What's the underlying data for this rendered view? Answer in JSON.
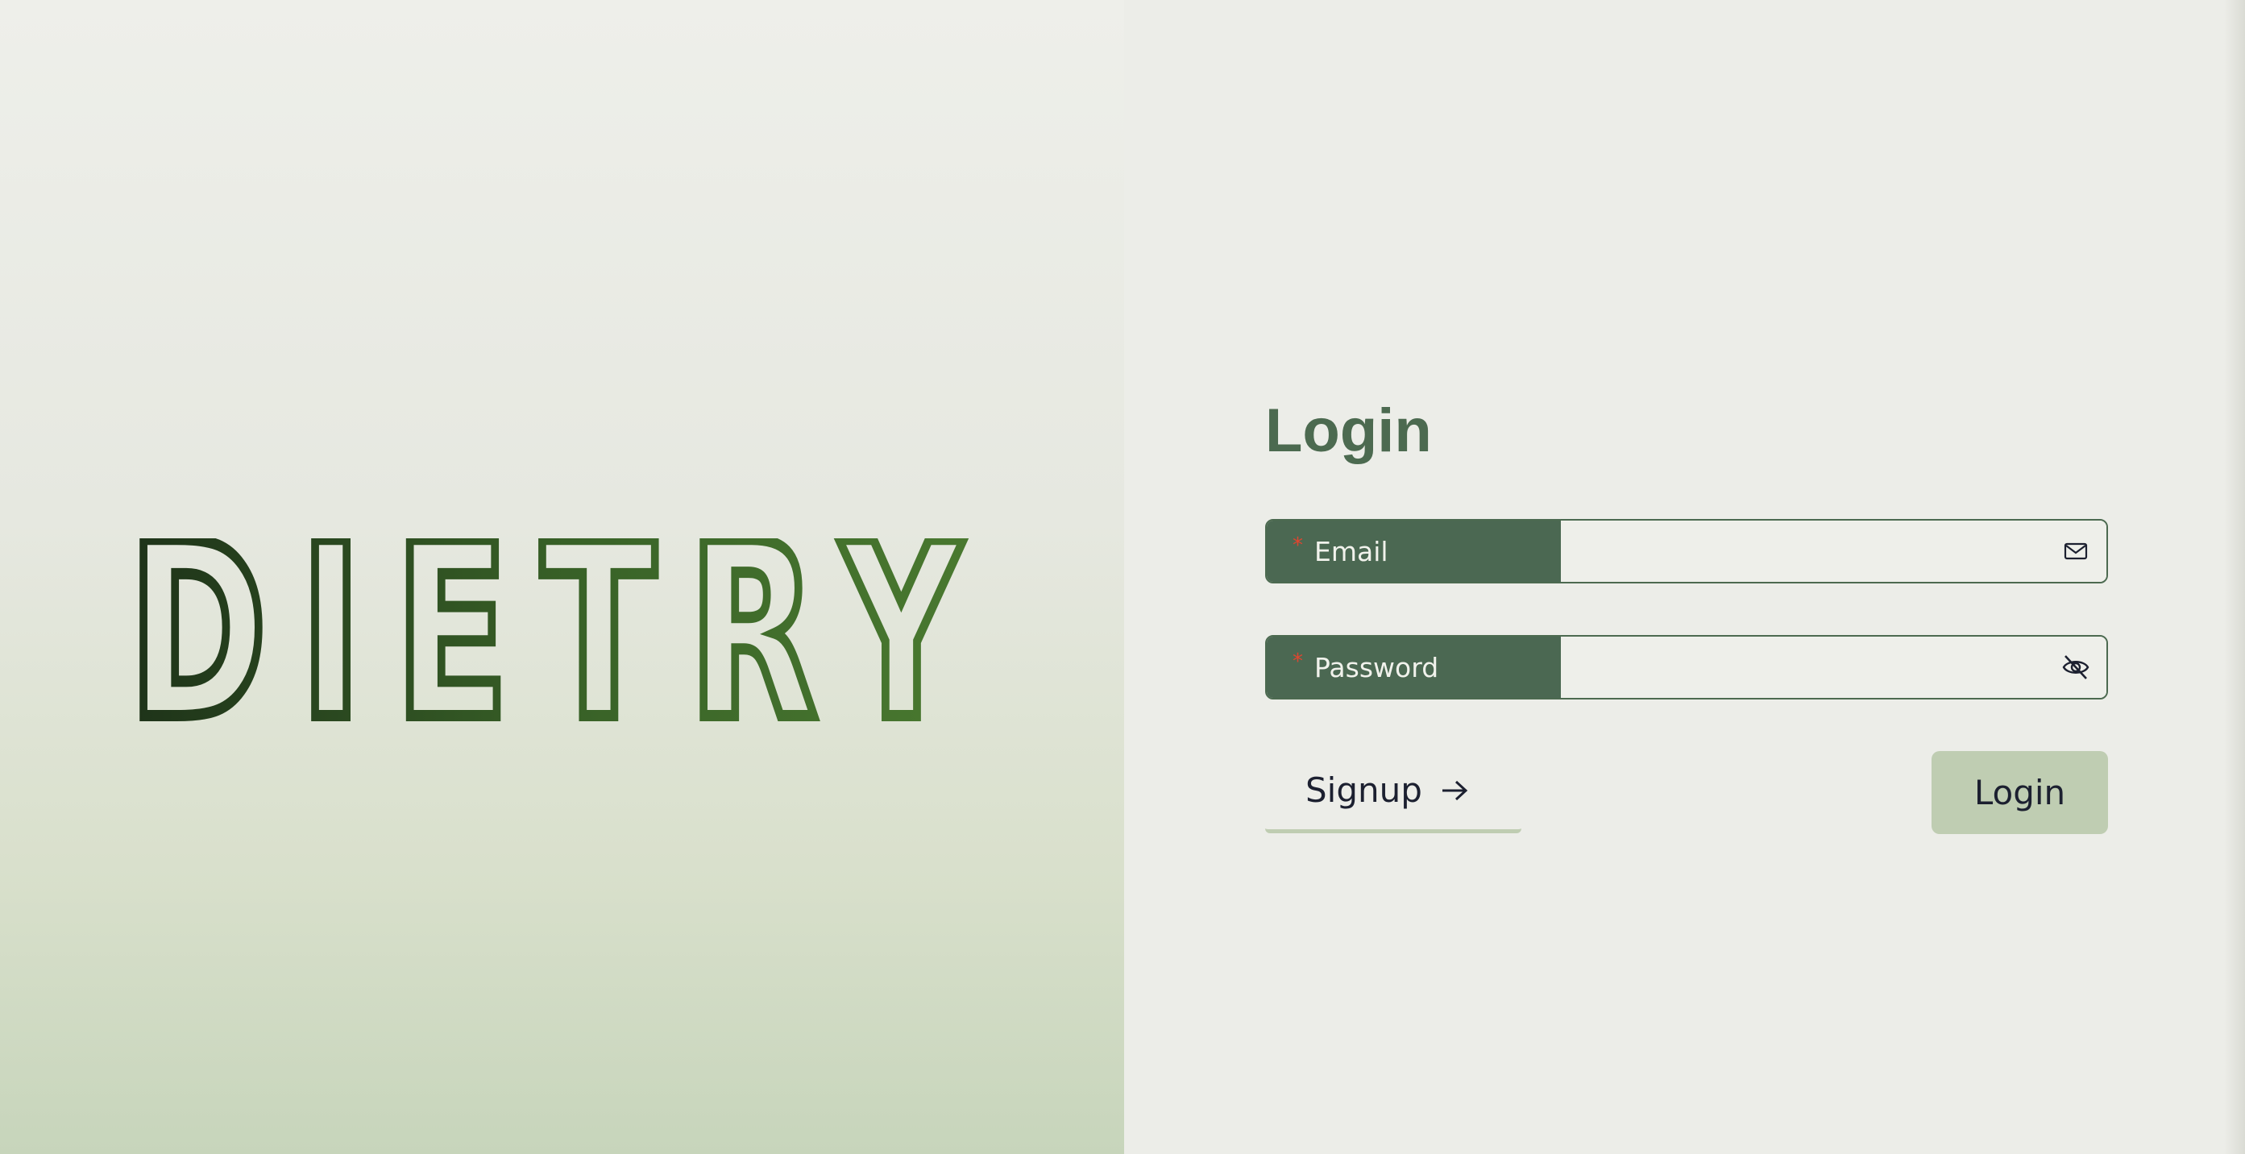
{
  "brand": {
    "logo_text": "DIETRY"
  },
  "login_form": {
    "title": "Login",
    "email": {
      "label": "Email",
      "required_mark": "*",
      "value": "",
      "icon": "mail-icon"
    },
    "password": {
      "label": "Password",
      "required_mark": "*",
      "value": "",
      "icon": "eye-slash-icon"
    },
    "signup_label": "Signup",
    "signup_icon": "arrow-right-icon",
    "login_label": "Login"
  },
  "colors": {
    "accent_green": "#4b6852",
    "button_green_light": "#bfcdb2",
    "required_red": "#e0452f",
    "background": "#ecede8"
  }
}
